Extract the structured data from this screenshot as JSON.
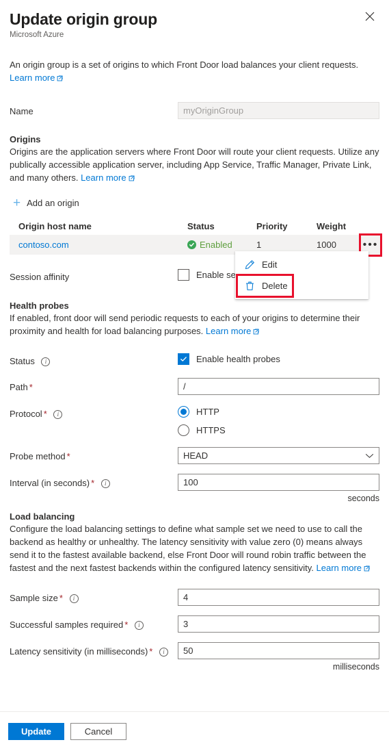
{
  "header": {
    "title": "Update origin group",
    "subtitle": "Microsoft Azure",
    "close_label": "Close"
  },
  "intro": {
    "text": "An origin group is a set of origins to which Front Door load balances your client requests.",
    "learn_more": "Learn more"
  },
  "name_field": {
    "label": "Name",
    "value": "myOriginGroup",
    "placeholder": "myOriginGroup"
  },
  "origins": {
    "section_title": "Origins",
    "section_desc": "Origins are the application servers where Front Door will route your client requests. Utilize any publically accessible application server, including App Service, Traffic Manager, Private Link, and many others.",
    "learn_more": "Learn more",
    "add_label": "Add an origin",
    "columns": [
      "Origin host name",
      "Status",
      "Priority",
      "Weight"
    ],
    "rows": [
      {
        "host": "contoso.com",
        "status": "Enabled",
        "priority": "1",
        "weight": "1000"
      }
    ],
    "menu": {
      "edit": "Edit",
      "delete": "Delete"
    }
  },
  "session_affinity": {
    "label": "Session affinity",
    "checkbox_label": "Enable se",
    "checked": false
  },
  "health_probes": {
    "section_title": "Health probes",
    "section_desc": "If enabled, front door will send periodic requests to each of your origins to determine their proximity and health for load balancing purposes.",
    "learn_more": "Learn more",
    "status_label": "Status",
    "status_checkbox_label": "Enable health probes",
    "path_label": "Path",
    "path_value": "/",
    "protocol_label": "Protocol",
    "protocol_options": [
      "HTTP",
      "HTTPS"
    ],
    "protocol_selected": "HTTP",
    "probe_method_label": "Probe method",
    "probe_method_value": "HEAD",
    "interval_label": "Interval (in seconds)",
    "interval_value": "100",
    "interval_unit": "seconds"
  },
  "load_balancing": {
    "section_title": "Load balancing",
    "section_desc": "Configure the load balancing settings to define what sample set we need to use to call the backend as healthy or unhealthy. The latency sensitivity with value zero (0) means always send it to the fastest available backend, else Front Door will round robin traffic between the fastest and the next fastest backends within the configured latency sensitivity.",
    "learn_more": "Learn more",
    "sample_size_label": "Sample size",
    "sample_size_value": "4",
    "successful_samples_label": "Successful samples required",
    "successful_samples_value": "3",
    "latency_label": "Latency sensitivity (in milliseconds)",
    "latency_value": "50",
    "latency_unit": "milliseconds"
  },
  "footer": {
    "update_label": "Update",
    "cancel_label": "Cancel"
  },
  "colors": {
    "accent": "#0078d4",
    "highlight": "#e8112d",
    "status_green": "#5d9e3d",
    "required": "#a4262c"
  }
}
